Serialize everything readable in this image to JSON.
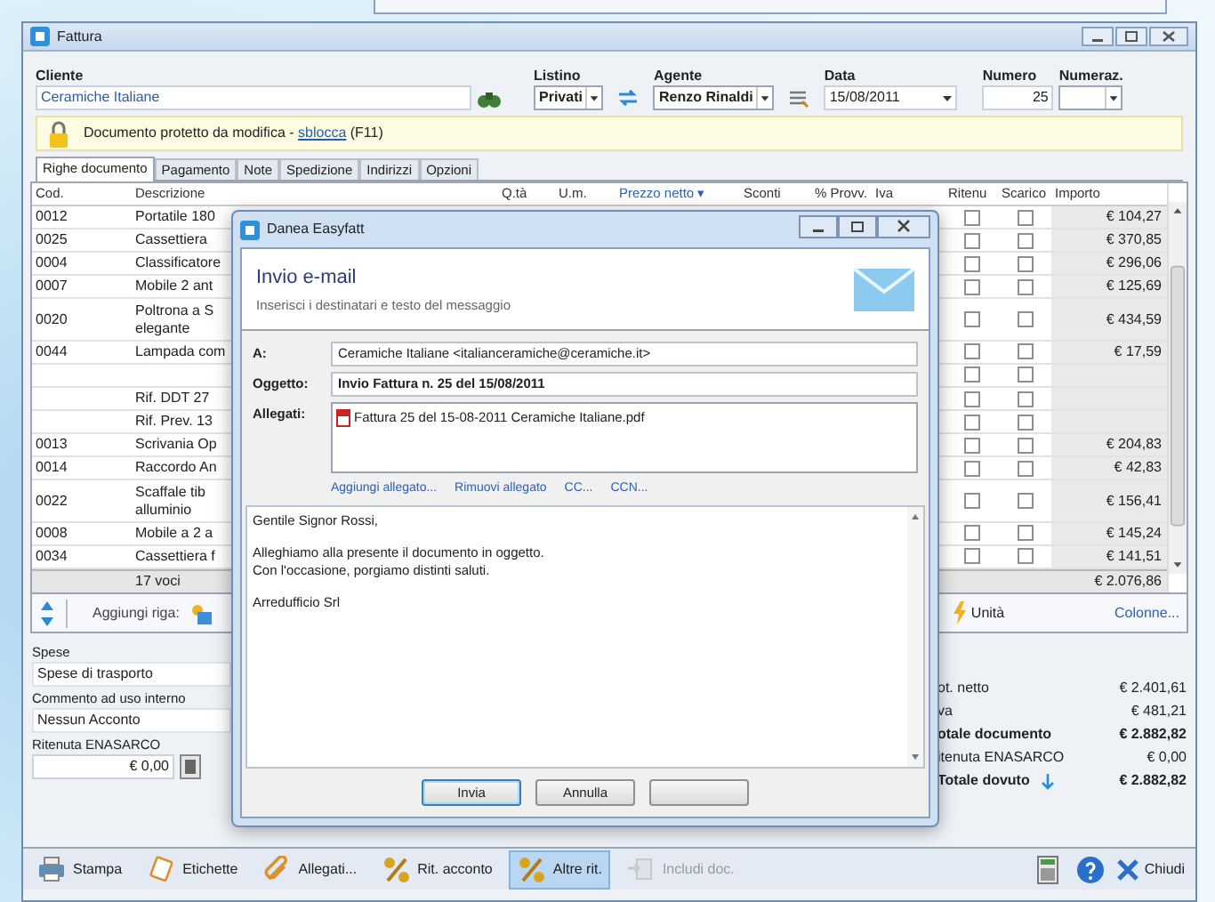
{
  "window": {
    "title": "Fattura"
  },
  "header": {
    "cliente": {
      "label": "Cliente",
      "value": "Ceramiche Italiane"
    },
    "listino": {
      "label": "Listino",
      "value": "Privati"
    },
    "agente": {
      "label": "Agente",
      "value": "Renzo Rinaldi"
    },
    "data": {
      "label": "Data",
      "value": "15/08/2011"
    },
    "numero": {
      "label": "Numero",
      "value": "25"
    },
    "numerazione": {
      "label": "Numeraz."
    }
  },
  "notice": {
    "text": "Documento protetto da modifica - ",
    "link": "sblocca",
    "shortcut": "(F11)"
  },
  "tabs": [
    {
      "label": "Righe documento",
      "selected": true
    },
    {
      "label": "Pagamento",
      "selected": false
    },
    {
      "label": "Note",
      "selected": false
    },
    {
      "label": "Spedizione",
      "selected": false
    },
    {
      "label": "Indirizzi",
      "selected": false
    },
    {
      "label": "Opzioni",
      "selected": false
    }
  ],
  "table": {
    "columns": [
      {
        "label": "Cod.",
        "active": false
      },
      {
        "label": "Descrizione",
        "active": false
      },
      {
        "label": "Q.tà",
        "active": false
      },
      {
        "label": "U.m.",
        "active": false
      },
      {
        "label": "Prezzo netto ▾",
        "active": true
      },
      {
        "label": "Sconti",
        "active": false
      },
      {
        "label": "% Provv.",
        "active": false
      },
      {
        "label": "Iva",
        "active": false
      },
      {
        "label": "Ritenu",
        "active": false
      },
      {
        "label": "Scarico",
        "active": false
      },
      {
        "label": "Importo",
        "active": false
      }
    ],
    "rows": [
      {
        "kind": "item",
        "code": "0012",
        "description": "Portatile 180",
        "ritenuta": false,
        "scarico": false,
        "amount": "€ 104,27"
      },
      {
        "kind": "item",
        "code": "0025",
        "description": "Cassettiera",
        "ritenuta": false,
        "scarico": false,
        "amount": "€ 370,85"
      },
      {
        "kind": "item",
        "code": "0004",
        "description": "Classificatore",
        "ritenuta": false,
        "scarico": false,
        "amount": "€ 296,06"
      },
      {
        "kind": "item",
        "code": "0007",
        "description": "Mobile 2 ant",
        "ritenuta": false,
        "scarico": false,
        "amount": "€ 125,69"
      },
      {
        "kind": "item",
        "code": "0020",
        "description": "Poltrona a S\nelegante",
        "ritenuta": false,
        "scarico": false,
        "amount": "€ 434,59"
      },
      {
        "kind": "item",
        "code": "0044",
        "description": "Lampada com",
        "ritenuta": false,
        "scarico": false,
        "amount": "€ 17,59"
      },
      {
        "kind": "blank",
        "ritenuta": false,
        "scarico": false
      },
      {
        "kind": "note",
        "description": "Rif. DDT 27",
        "ritenuta": false,
        "scarico": false
      },
      {
        "kind": "note",
        "description": "Rif. Prev. 13",
        "ritenuta": false,
        "scarico": false
      },
      {
        "kind": "item",
        "code": "0013",
        "description": "Scrivania Op",
        "ritenuta": false,
        "scarico": false,
        "amount": "€ 204,83"
      },
      {
        "kind": "item",
        "code": "0014",
        "description": "Raccordo An",
        "ritenuta": false,
        "scarico": false,
        "amount": "€ 42,83"
      },
      {
        "kind": "item",
        "code": "0022",
        "description": "Scaffale tib\nalluminio",
        "ritenuta": false,
        "scarico": false,
        "amount": "€ 156,41"
      },
      {
        "kind": "item",
        "code": "0008",
        "description": "Mobile a 2 a",
        "ritenuta": false,
        "scarico": false,
        "amount": "€ 145,24"
      },
      {
        "kind": "item",
        "code": "0034",
        "description": "Cassettiera f",
        "ritenuta": false,
        "scarico": false,
        "amount": "€ 141,51"
      }
    ],
    "footer": {
      "count": "17 voci",
      "total": "€ 2.076,86"
    }
  },
  "row_toolbar": {
    "add_label": "Aggiungi riga:",
    "units": "Unità",
    "columns_link": "Colonne..."
  },
  "left_fields": [
    {
      "label": "Spese",
      "value": "Spese di trasporto",
      "kind": "text"
    },
    {
      "label": "Commento ad uso interno",
      "value": "Nessun Acconto",
      "kind": "text"
    },
    {
      "label": "Ritenuta ENASARCO",
      "value": "€ 0,00",
      "kind": "amount"
    }
  ],
  "totals": [
    {
      "label": "ot. netto",
      "value": "€ 2.401,61",
      "bold": false
    },
    {
      "label": "va",
      "value": "€ 481,21",
      "bold": false
    },
    {
      "label": "otale documento",
      "value": "€ 2.882,82",
      "bold": true
    },
    {
      "label": "itenuta ENASARCO",
      "value": "€ 0,00",
      "bold": false
    },
    {
      "label": "Totale dovuto",
      "value": "€ 2.882,82",
      "bold": true,
      "info": true
    }
  ],
  "toolbar": [
    {
      "label": "Stampa",
      "selected": false,
      "disabled": false
    },
    {
      "label": "Etichette",
      "selected": false,
      "disabled": false
    },
    {
      "label": "Allegati...",
      "selected": false,
      "disabled": false
    },
    {
      "label": "Rit. acconto",
      "selected": false,
      "disabled": false
    },
    {
      "label": "Altre rit.",
      "selected": true,
      "disabled": false
    },
    {
      "label": "Includi doc.",
      "selected": false,
      "disabled": true
    }
  ],
  "close_label": "Chiudi",
  "dialog": {
    "title": "Danea Easyfatt",
    "heading": "Invio e-mail",
    "subheading": "Inserisci i destinatari e testo del messaggio",
    "fields": [
      {
        "label": "A:",
        "value": "Ceramiche Italiane <italianceramiche@ceramiche.it>",
        "kind": "text"
      },
      {
        "label": "Oggetto:",
        "value": "Invio Fattura n. 25 del 15/08/2011",
        "kind": "bold"
      },
      {
        "label": "Allegati:",
        "value": "Fattura 25 del 15-08-2011 Ceramiche Italiane.pdf",
        "kind": "attachments"
      }
    ],
    "links": [
      "Aggiungi allegato...",
      "Rimuovi allegato",
      "CC...",
      "CCN..."
    ],
    "message": [
      "Gentile Signor Rossi,",
      "Alleghiamo alla presente il documento in oggetto.\nCon l'occasione, porgiamo distinti saluti.",
      "Arredufficio Srl"
    ],
    "buttons": [
      {
        "label": "Invia",
        "selected": true
      },
      {
        "label": "Annulla",
        "selected": false
      }
    ]
  }
}
